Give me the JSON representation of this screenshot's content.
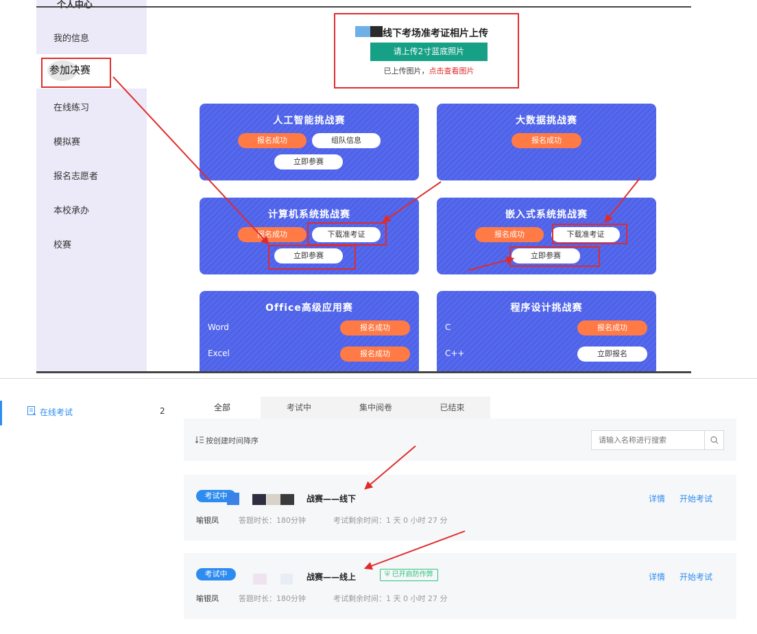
{
  "portal": {
    "sidebar_header": "个人中心",
    "sidebar_items": [
      "我的信息",
      "参加决赛",
      "在线练习",
      "模拟赛",
      "报名志愿者",
      "本校承办",
      "校赛"
    ],
    "upload": {
      "title": "线下考场准考证相片上传",
      "button": "请上传2寸蓝底照片",
      "status_prefix": "已上传图片，",
      "status_link": "点击查看图片"
    },
    "cards": {
      "ai": {
        "title": "人工智能挑战赛",
        "signed": "报名成功",
        "team": "组队信息",
        "join": "立即参赛"
      },
      "bigdata": {
        "title": "大数据挑战赛",
        "signed": "报名成功"
      },
      "cs": {
        "title": "计算机系统挑战赛",
        "signed": "报名成功",
        "download": "下载准考证",
        "join": "立即参赛"
      },
      "embedded": {
        "title": "嵌入式系统挑战赛",
        "signed": "报名成功",
        "download": "下载准考证",
        "join": "立即参赛"
      },
      "office": {
        "title": "Office高级应用赛",
        "rows": [
          {
            "label": "Word",
            "status": "报名成功"
          },
          {
            "label": "Excel",
            "status": "报名成功"
          }
        ]
      },
      "programming": {
        "title": "程序设计挑战赛",
        "rows": [
          {
            "label": "C",
            "status": "报名成功"
          },
          {
            "label": "C++",
            "status": "立即报名"
          }
        ]
      }
    }
  },
  "online_exam": {
    "sidebar": {
      "label": "在线考试",
      "count": "2"
    },
    "tabs": [
      "全部",
      "考试中",
      "集中阅卷",
      "已结束"
    ],
    "active_tab": "全部",
    "sort_label": "按创建时间降序",
    "search_placeholder": "请输入名称进行搜索",
    "exams": [
      {
        "status": "考试中",
        "title": "战赛——线下",
        "teacher": "喻银凤",
        "duration": "答题时长：180分钟",
        "remaining": "考试剩余时间：1 天 0 小时 27 分",
        "actions": [
          "详情",
          "开始考试"
        ]
      },
      {
        "status": "考试中",
        "title": "战赛——线上",
        "proctor": "已开启防作弊",
        "teacher": "喻银凤",
        "duration": "答题时长：180分钟",
        "remaining": "考试剩余时间：1 天 0 小时 27 分",
        "actions": [
          "详情",
          "开始考试"
        ]
      }
    ]
  },
  "colors": {
    "card_blue": "#4f63ea",
    "pill_orange": "#ff7a45",
    "annotation_red": "#e02b2b",
    "primary_blue": "#2d8cf0",
    "upload_green": "#16a085"
  }
}
